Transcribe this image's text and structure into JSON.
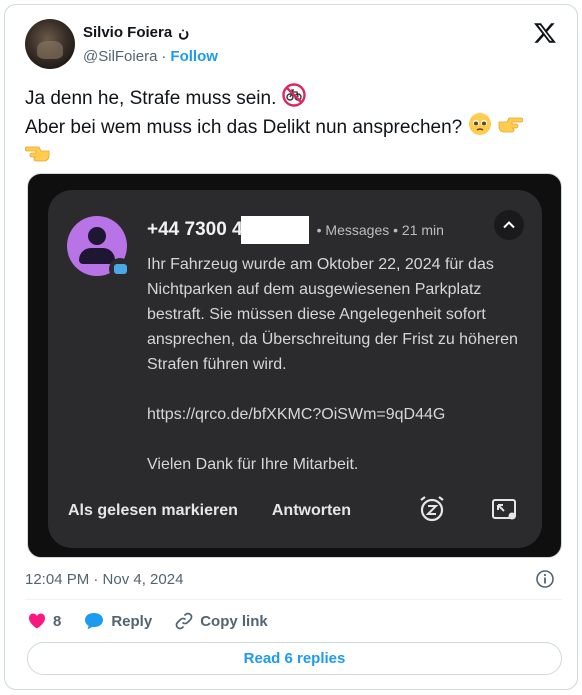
{
  "author": {
    "display_name": "Silvio Foiera",
    "name_suffix": "ن",
    "handle": "@SilFoiera",
    "follow_label": "Follow"
  },
  "tweet": {
    "line1": "Ja denn he, Strafe muss sein.",
    "line2": "Aber bei wem muss ich das Delikt nun ansprechen?",
    "emoji_icons": [
      "no-bicycles-icon",
      "pleading-face-icon",
      "pointing-right-icon",
      "pointing-left-icon"
    ]
  },
  "notification": {
    "sender_number": "+44 7300 4",
    "app_name": "Messages",
    "time": "21 min",
    "body_paragraph1": "Ihr Fahrzeug wurde am Oktober 22, 2024 für das Nichtparken auf dem ausgewiesenen Parkplatz bestraft. Sie müssen diese Angelegenheit sofort ansprechen, da Überschreitung der Frist zu höheren Strafen führen wird.",
    "body_link": "https://qrco.de/bfXKMC?OiSWm=9qD44G",
    "body_closing": "Vielen Dank für Ihre Mitarbeit.",
    "mark_read_label": "Als gelesen markieren",
    "reply_label": "Antworten",
    "avatar_color": "#b874e6"
  },
  "footer": {
    "timestamp": "12:04 PM · Nov 4, 2024",
    "like_count": "8",
    "reply_label": "Reply",
    "copy_link_label": "Copy link",
    "read_replies_label": "Read 6 replies"
  },
  "colors": {
    "accent": "#1d9bf0",
    "like": "#f91880",
    "muted": "#536471"
  }
}
